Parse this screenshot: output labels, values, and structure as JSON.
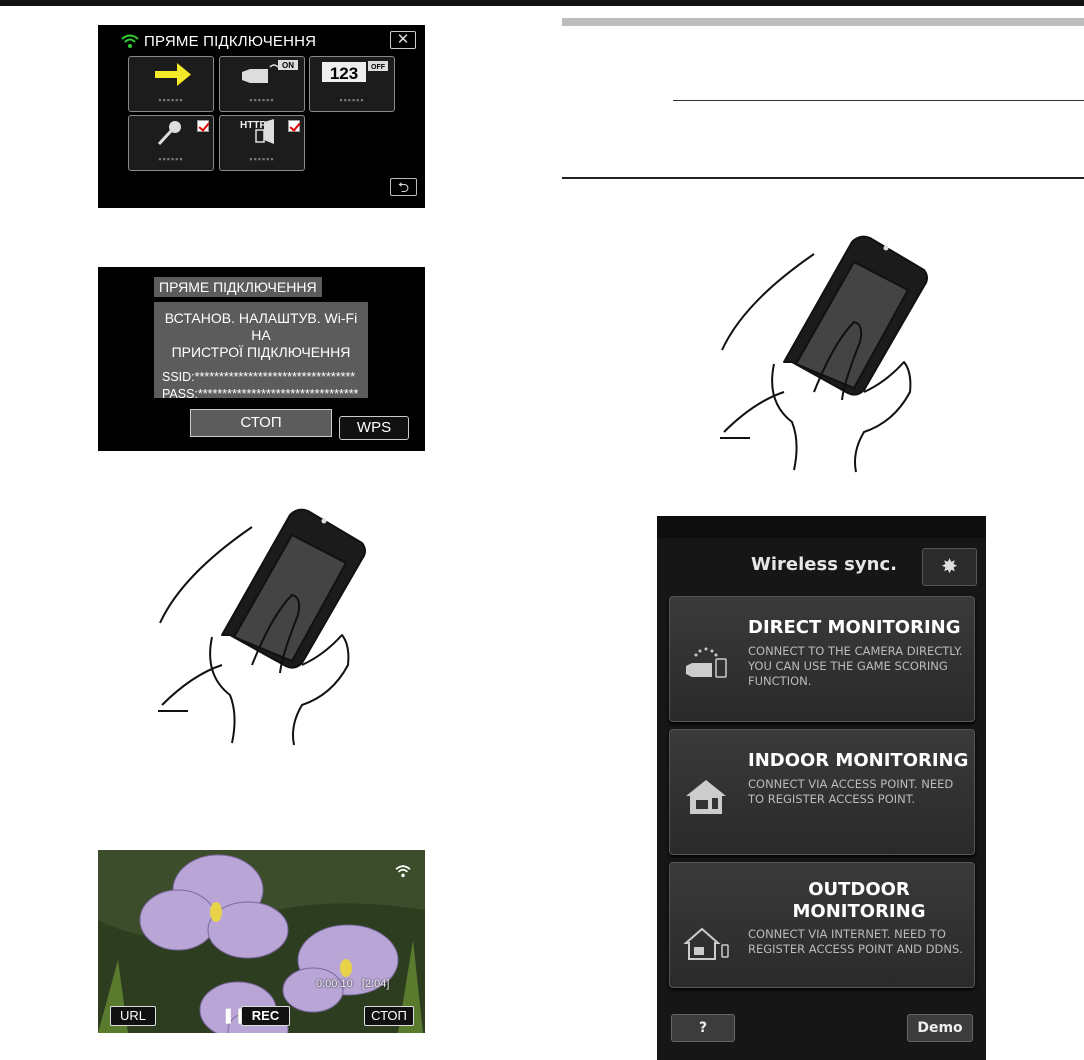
{
  "screen_direct": {
    "title": "ПРЯМЕ ПІДКЛЮЧЕННЯ",
    "close_glyph": "✕",
    "tile_placeholder": "▪▪▪▪▪▪",
    "tile_icons": [
      "arrow-right-icon",
      "video-camera-wifi-on-icon",
      "counter-123-off-icon",
      "key-icon",
      "http-door-icon"
    ],
    "camera_badge": "ON",
    "counter_text": "123",
    "counter_badge": "OFF",
    "http_text": "HTTP",
    "back_glyph": "⮌"
  },
  "screen_settings": {
    "heading": "ПРЯМЕ ПІДКЛЮЧЕННЯ",
    "message_line1": "ВСТАНОВ. НАЛАШТУВ. Wi-Fi НА",
    "message_line2": "ПРИСТРОЇ ПІДКЛЮЧЕННЯ",
    "ssid": "SSID:*********************************",
    "pass": "PASS:*********************************",
    "stop_label": "СТОП",
    "wps_label": "WPS"
  },
  "screen_recording": {
    "url_label": "URL",
    "pause_glyph": "❚❚",
    "rec_label": "REC",
    "time": "0:00:10",
    "remaining": "[2:04]",
    "stop_label": "СТОП"
  },
  "app": {
    "title": "Wireless sync.",
    "gear_glyph": "✸",
    "cards": [
      {
        "title": "DIRECT MONITORING",
        "desc": "Connect to the camera directly. You can use the game scoring function."
      },
      {
        "title": "INDOOR MONITORING",
        "desc": "Connect via access point. Need to register access point."
      },
      {
        "title_line1": "OUTDOOR",
        "title_line2": "MONITORING",
        "desc": "Connect via internet. Need to register access point and DDNS."
      }
    ],
    "help_label": "?",
    "demo_label": "Demo"
  }
}
